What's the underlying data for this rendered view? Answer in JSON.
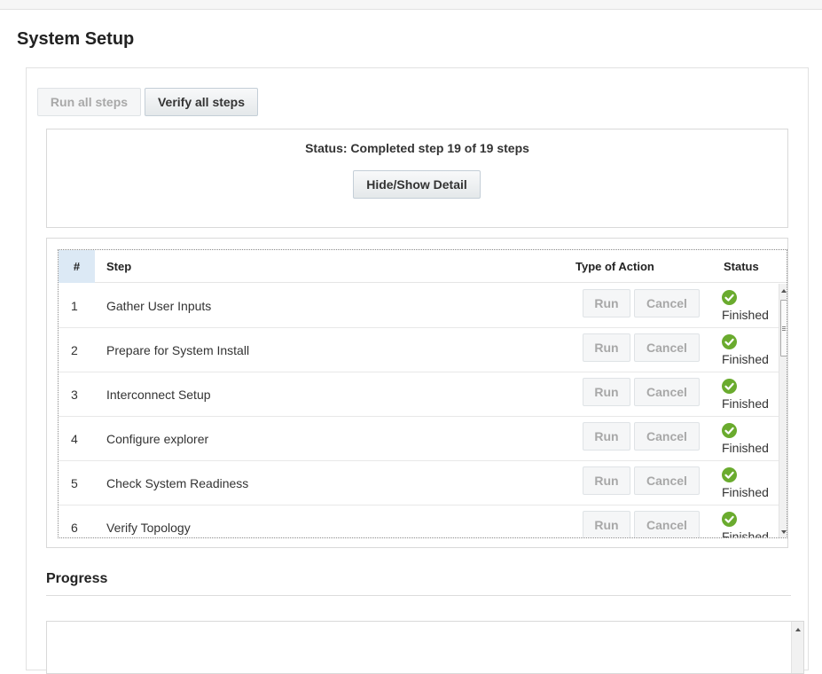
{
  "page": {
    "title": "System Setup"
  },
  "toolbar": {
    "run_all_label": "Run all steps",
    "verify_all_label": "Verify all steps"
  },
  "status": {
    "text": "Status: Completed step 19 of 19 steps",
    "toggle_label": "Hide/Show Detail"
  },
  "table": {
    "columns": {
      "num": "#",
      "step": "Step",
      "action": "Type of Action",
      "status": "Status"
    },
    "run_label": "Run",
    "cancel_label": "Cancel",
    "rows": [
      {
        "num": "1",
        "step": "Gather User Inputs",
        "status": "Finished"
      },
      {
        "num": "2",
        "step": "Prepare for System Install",
        "status": "Finished"
      },
      {
        "num": "3",
        "step": "Interconnect Setup",
        "status": "Finished"
      },
      {
        "num": "4",
        "step": "Configure explorer",
        "status": "Finished"
      },
      {
        "num": "5",
        "step": "Check System Readiness",
        "status": "Finished"
      },
      {
        "num": "6",
        "step": "Verify Topology",
        "status": "Finished"
      }
    ]
  },
  "progress": {
    "title": "Progress"
  },
  "colors": {
    "success_green": "#6aab2e",
    "header_highlight": "#dce9f5"
  },
  "icons": {
    "status_icon": "check-circle-icon"
  }
}
